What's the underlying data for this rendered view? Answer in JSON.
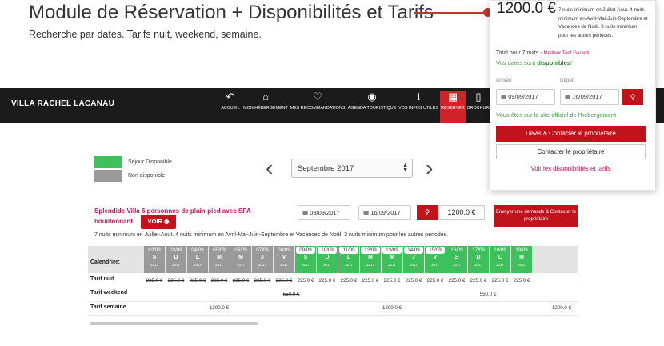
{
  "slide": {
    "title": "Module de Réservation + Disponibilités et Tarifs",
    "subtitle": "Recherche par dates. Tarifs nuit, weekend, semaine."
  },
  "navbar": {
    "brand": "VILLA RACHEL LACANAU",
    "items": [
      {
        "label": "ACCUEIL",
        "icon": "back-arrow-icon"
      },
      {
        "label": "MON HÉBERGEMENT",
        "icon": "home-icon"
      },
      {
        "label": "MES RECOMMANDATIONS",
        "icon": "heart-icon"
      },
      {
        "label": "AGENDA TOURISTIQUE",
        "icon": "rss-icon"
      },
      {
        "label": "VOS INFOS UTILES",
        "icon": "info-icon"
      },
      {
        "label": "RÉSERVER",
        "icon": "calendar-icon",
        "active": true
      },
      {
        "label": "BROCHURE",
        "icon": "pdf-icon"
      }
    ]
  },
  "legend": {
    "available": "Séjour Disponible",
    "unavailable": "Non disponible",
    "available_color": "#3ec15a",
    "unavailable_color": "#9a9a9a"
  },
  "calendar": {
    "month": "Septembre 2017",
    "prev_icon": "chevron-left-icon",
    "next_icon": "chevron-right-icon"
  },
  "property": {
    "title": "Splendide Villa 6 personnes de plain-pied avec SPA bouillonnant.",
    "voir_label": "VOIR",
    "arrival": "09/09/2017",
    "departure": "16/09/2017",
    "price": "1200.0 €",
    "request_label": "Envoyer une demande & Contacter le propriétaire",
    "min_nights": "7 nuits minimum en Juillet-Aout. 4 nuits minimum en Avril-Mai-Juin-Septembre et Vacances de Noël. 3 nuits minimum pour les autres périodes."
  },
  "grid": {
    "row_labels": {
      "calendar": "Calendrier:",
      "night": "Tarif nuit",
      "weekend": "Tarif weekend",
      "week": "Tarif semaine"
    },
    "days": [
      {
        "date": "02/09",
        "dow": "S",
        "year": "2017",
        "status": "unavailable",
        "night": "225.0 €"
      },
      {
        "date": "03/09",
        "dow": "D",
        "year": "2017",
        "status": "unavailable",
        "night": "225.0 €"
      },
      {
        "date": "04/09",
        "dow": "L",
        "year": "2017",
        "status": "unavailable",
        "night": "225.0 €"
      },
      {
        "date": "05/09",
        "dow": "M",
        "year": "2017",
        "status": "unavailable",
        "night": "225.0 €"
      },
      {
        "date": "06/09",
        "dow": "M",
        "year": "2017",
        "status": "unavailable",
        "night": "225.0 €"
      },
      {
        "date": "07/09",
        "dow": "J",
        "year": "2017",
        "status": "unavailable",
        "night": "225.0 €"
      },
      {
        "date": "08/09",
        "dow": "V",
        "year": "2017",
        "status": "unavailable",
        "night": "225.0 €"
      },
      {
        "date": "09/09",
        "dow": "S",
        "year": "2017",
        "status": "selected",
        "night": "225.0 €"
      },
      {
        "date": "10/09",
        "dow": "D",
        "year": "2017",
        "status": "selected",
        "night": "225.0 €"
      },
      {
        "date": "11/09",
        "dow": "L",
        "year": "2017",
        "status": "selected",
        "night": "225.0 €"
      },
      {
        "date": "12/09",
        "dow": "M",
        "year": "2017",
        "status": "selected",
        "night": "225.0 €"
      },
      {
        "date": "13/09",
        "dow": "M",
        "year": "2017",
        "status": "selected",
        "night": "225.0 €"
      },
      {
        "date": "14/09",
        "dow": "J",
        "year": "2017",
        "status": "selected",
        "night": "225.0 €"
      },
      {
        "date": "15/09",
        "dow": "V",
        "year": "2017",
        "status": "selected",
        "night": "225.0 €"
      },
      {
        "date": "16/09",
        "dow": "S",
        "year": "2017",
        "status": "available",
        "night": "225.0 €"
      },
      {
        "date": "17/09",
        "dow": "D",
        "year": "2017",
        "status": "available",
        "night": "225.0 €"
      },
      {
        "date": "18/09",
        "dow": "L",
        "year": "2017",
        "status": "available",
        "night": "225.0 €"
      },
      {
        "date": "19/09",
        "dow": "M",
        "year": "2017",
        "status": "available",
        "night": "225.0 €"
      }
    ],
    "weekend_unavail": "550.0 €",
    "weekend_avail": "550.0 €",
    "week_unavail": "1200.0 €",
    "week_mid": "1200.0 €",
    "week_end": "1200.0 €"
  },
  "popup": {
    "price": "1200.0 €",
    "min_nights": "7 nuits minimum en Juillet-Aout. 4 nuits minimum en Avril-Mai-Juin-Septembre et Vacances de Noël. 3 nuits minimum pour les autres périodes.",
    "total_label": "Total pour 7 nuits - ",
    "best_rate": "Meilleur Tarif Garanti",
    "available_msg_prefix": "Vos dates sont ",
    "available_msg_word": "disponibles",
    "available_msg_suffix": "!",
    "arrival_label": "Arrivée",
    "departure_label": "Départ",
    "arrival": "09/09/2017",
    "departure": "16/09/2017",
    "official_site": "Vous êtes sur le site officiel de l'hébergement",
    "contact_devis": "Devis & Contacter le propriétaire",
    "contact_owner": "Contacter le propriétaire",
    "see_availability": "Voir les disponibilités et tarifs"
  },
  "colors": {
    "accent_red": "#c0131c",
    "green": "#3ec15a",
    "grey": "#9a9a9a",
    "link_pink": "#c2185b"
  }
}
